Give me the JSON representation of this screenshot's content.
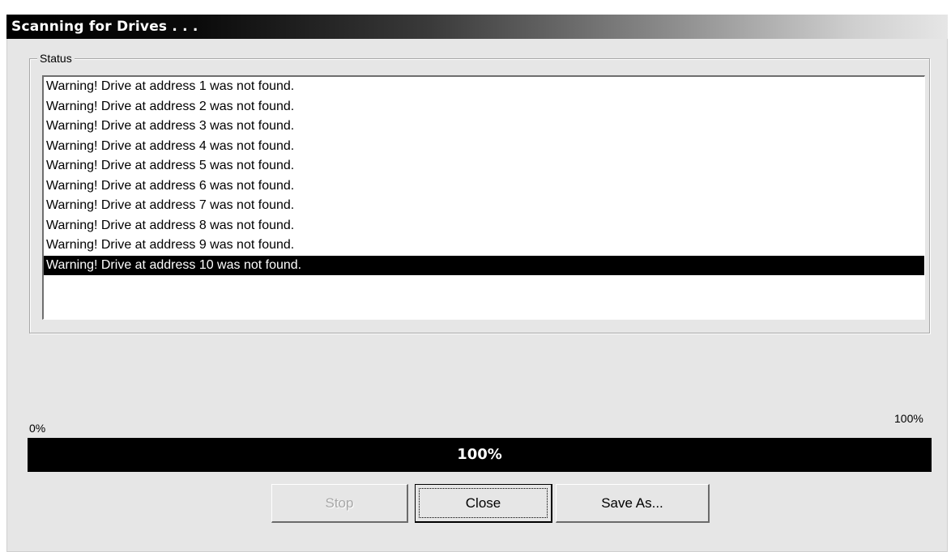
{
  "window": {
    "title": "Scanning for Drives . . ."
  },
  "status": {
    "label": "Status",
    "items": [
      "Warning! Drive at address 1 was not found.",
      "Warning! Drive at address 2 was not found.",
      "Warning! Drive at address 3 was not found.",
      "Warning! Drive at address 4 was not found.",
      "Warning! Drive at address 5 was not found.",
      "Warning! Drive at address 6 was not found.",
      "Warning! Drive at address 7 was not found.",
      "Warning! Drive at address 8 was not found.",
      "Warning! Drive at address 9 was not found.",
      "Warning! Drive at address 10 was not found."
    ],
    "selected_index": 9
  },
  "progress": {
    "min_label": "0%",
    "max_label": "100%",
    "value_label": "100%",
    "value_percent": 100
  },
  "buttons": {
    "stop": "Stop",
    "close": "Close",
    "save_as": "Save As..."
  }
}
